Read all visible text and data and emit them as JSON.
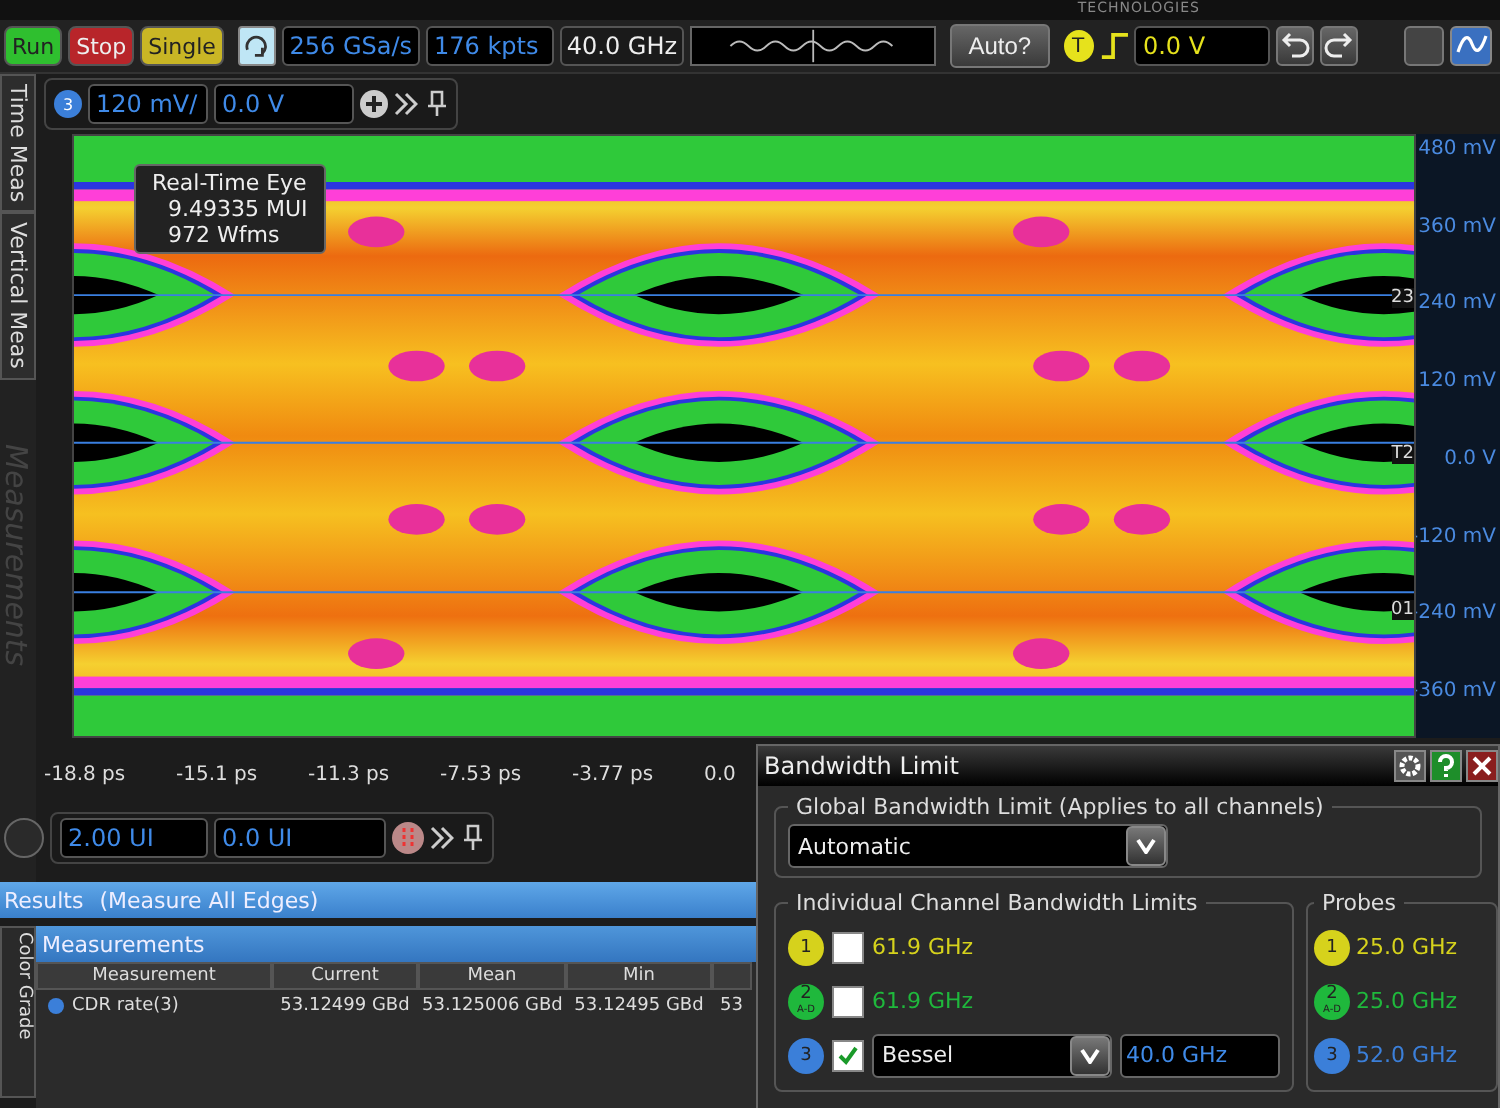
{
  "brand": "TECHNOLOGIES",
  "toolbar": {
    "acquisition_buttons": [
      {
        "label": "Run",
        "kind": "run"
      },
      {
        "label": "Stop",
        "kind": "stop"
      },
      {
        "label": "Single",
        "kind": "single"
      }
    ],
    "sample_rate": "256 GSa/s",
    "memory_depth": "176 kpts",
    "bandwidth": "40.0 GHz",
    "auto_button": "Auto?",
    "trigger": {
      "badge": "T",
      "level": "0.0 V"
    }
  },
  "side_tabs": [
    {
      "label": "Time Meas",
      "disabled": false
    },
    {
      "label": "Vertical Meas",
      "disabled": false
    },
    {
      "label": "Measurements",
      "disabled": true
    }
  ],
  "channel": {
    "number": "3",
    "scale": "120 mV/",
    "offset": "0.0 V"
  },
  "waveform": {
    "tooltip": {
      "title": "Real-Time Eye",
      "lines": [
        "9.49335 MUI",
        "972 Wfms"
      ]
    },
    "y_labels": [
      "480 mV",
      "360 mV",
      "240 mV",
      "120 mV",
      "0.0 V",
      "-120 mV",
      "-240 mV",
      "-360 mV"
    ],
    "x_labels": [
      "-18.8 ps",
      "-15.1 ps",
      "-11.3 ps",
      "-7.53 ps",
      "-3.77 ps",
      "0.0"
    ],
    "markers": [
      "23",
      "T2",
      "01"
    ]
  },
  "timebase": {
    "scale": "2.00 UI",
    "position": "0.0 UI"
  },
  "results": {
    "title": "Results",
    "subtitle": "(Measure All Edges)"
  },
  "color_grade_tab": "Color Grade",
  "measurements": {
    "title": "Measurements",
    "columns": [
      "Measurement",
      "Current",
      "Mean",
      "Min"
    ],
    "rows": [
      {
        "name": "CDR rate(3)",
        "values": [
          "53.12499 GBd",
          "53.125006 GBd",
          "53.12495 GBd",
          "53"
        ]
      }
    ]
  },
  "dialog": {
    "title": "Bandwidth Limit",
    "global": {
      "legend": "Global Bandwidth Limit (Applies to all channels)",
      "value": "Automatic"
    },
    "individual": {
      "legend": "Individual Channel Bandwidth Limits",
      "channels": [
        {
          "number": "1",
          "color": "#d6d21c",
          "checked": false,
          "kind": "fixed",
          "value": "61.9 GHz"
        },
        {
          "number": "2",
          "sublabel": "A-D",
          "color": "#1fb83c",
          "checked": false,
          "kind": "fixed",
          "value": "61.9 GHz"
        },
        {
          "number": "3",
          "color": "#3b7fd9",
          "checked": true,
          "kind": "filter",
          "filter": "Bessel",
          "value": "40.0 GHz"
        }
      ]
    },
    "probes": {
      "legend": "Probes",
      "channels": [
        {
          "number": "1",
          "color": "#d6d21c",
          "value": "25.0 GHz"
        },
        {
          "number": "2",
          "sublabel": "A-D",
          "color": "#1fb83c",
          "value": "25.0 GHz"
        },
        {
          "number": "3",
          "color": "#3b7fd9",
          "value": "52.0 GHz"
        }
      ]
    }
  }
}
